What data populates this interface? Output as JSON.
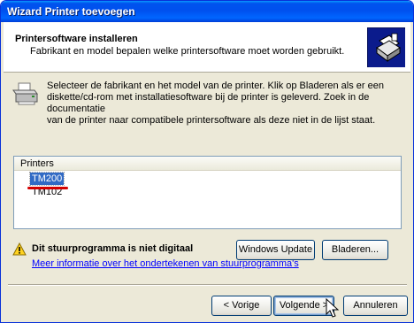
{
  "window": {
    "title": "Wizard Printer toevoegen"
  },
  "header": {
    "title": "Printersoftware installeren",
    "subtitle": "Fabrikant en model bepalen welke printersoftware moet worden gebruikt.",
    "icon": "printer-wizard-icon"
  },
  "intro": {
    "icon": "printer-icon",
    "lines": [
      "Selecteer de fabrikant en het model van de printer. Klik op Bladeren als er een",
      "diskette/cd-rom met installatiesoftware bij de printer is geleverd. Zoek in de documentatie",
      "van de printer naar compatibele printersoftware als deze niet in de lijst staat."
    ]
  },
  "printers": {
    "header": "Printers",
    "items": [
      {
        "label": "TM200",
        "selected": true
      },
      {
        "label": "TM102",
        "selected": false
      }
    ]
  },
  "warning": {
    "icon": "warning-icon",
    "text": "Dit stuurprogramma is niet digitaal",
    "link": "Meer informatie over het ondertekenen van stuurprogramma's"
  },
  "buttons": {
    "windows_update": "Windows Update",
    "browse": "Bladeren...",
    "back": "< Vorige",
    "next": "Volgende >",
    "cancel": "Annuleren"
  },
  "colors": {
    "titlebar": "#0053ee",
    "selection": "#316ac5",
    "annotation": "#d40000",
    "link": "#0000ff"
  }
}
